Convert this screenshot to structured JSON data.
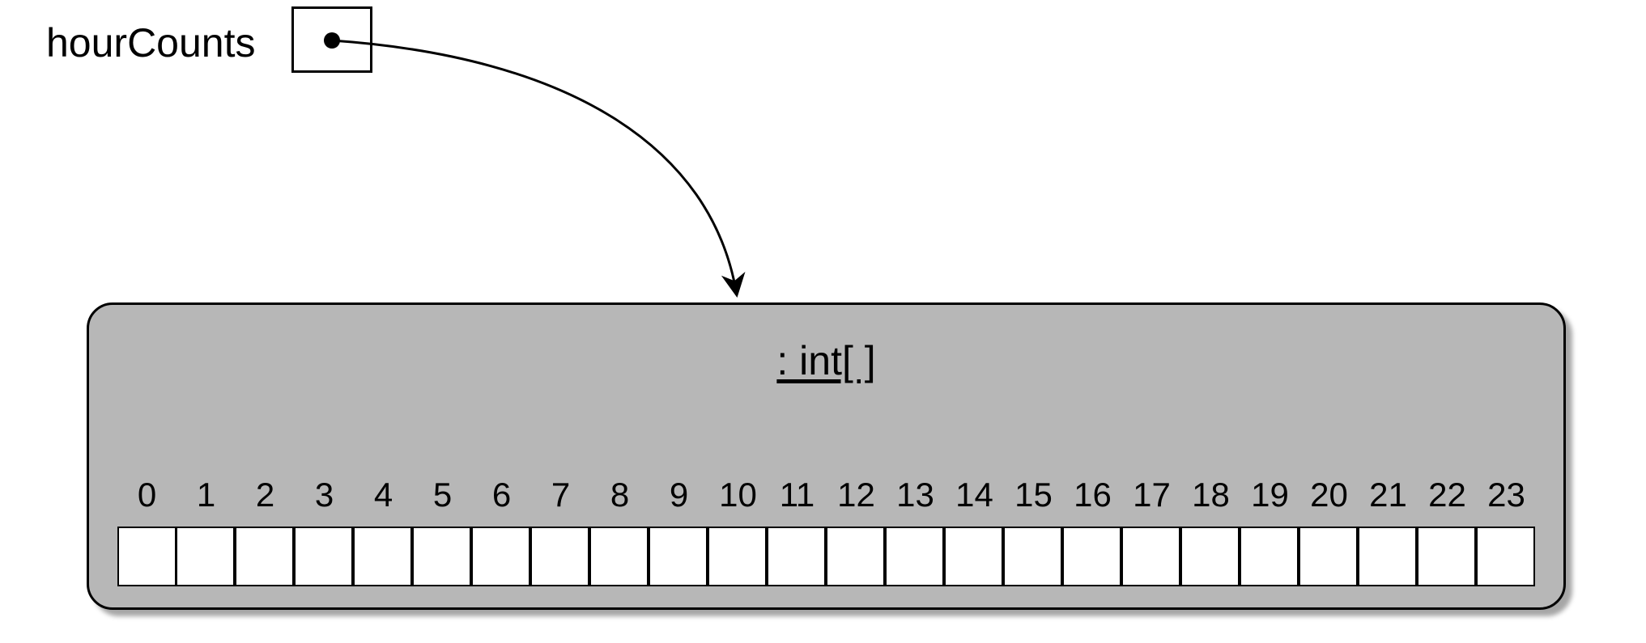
{
  "variable": {
    "name": "hourCounts"
  },
  "object": {
    "type_label": ": int[ ]",
    "indices": [
      "0",
      "1",
      "2",
      "3",
      "4",
      "5",
      "6",
      "7",
      "8",
      "9",
      "10",
      "11",
      "12",
      "13",
      "14",
      "15",
      "16",
      "17",
      "18",
      "19",
      "20",
      "21",
      "22",
      "23"
    ]
  }
}
